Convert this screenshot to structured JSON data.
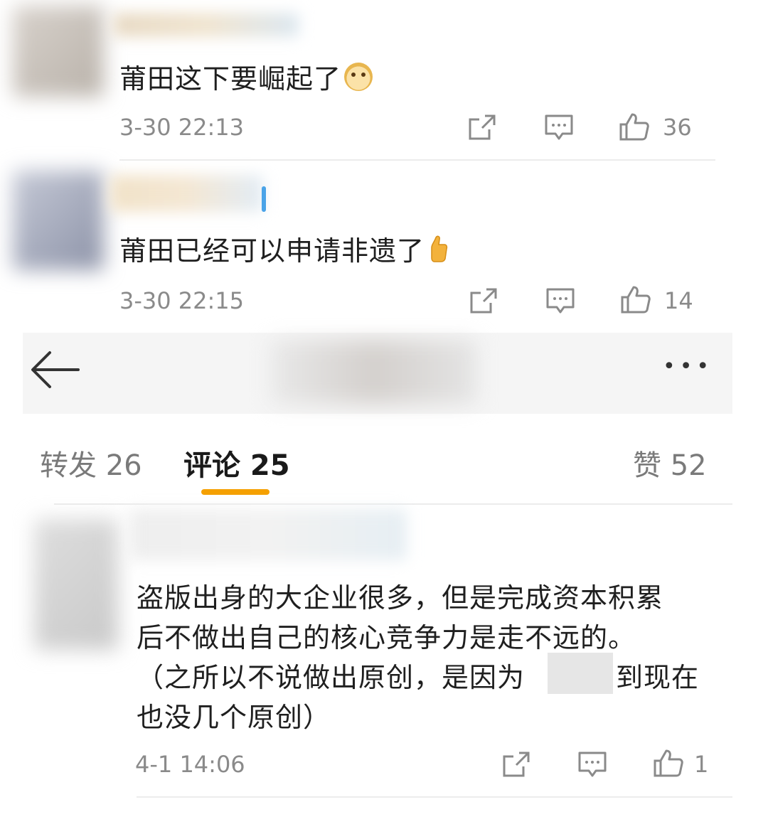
{
  "comments_top": [
    {
      "text": "莆田这下要崛起了",
      "emoji": "doge-emoji",
      "time": "3-30 22:13",
      "likes": "36"
    },
    {
      "text": "莆田已经可以申请非遗了",
      "emoji": "thumbs-up-emoji",
      "time": "3-30 22:15",
      "likes": "14"
    }
  ],
  "header": {
    "more_label": "•••"
  },
  "tabs": [
    {
      "label": "转发 26"
    },
    {
      "label": "评论 25"
    },
    {
      "label": "赞 52"
    }
  ],
  "comment_main": {
    "lines": [
      "盗版出身的大企业很多，但是完成资本积累",
      "后不做出自己的核心竞争力是走不远的。",
      "（之所以不说做出原创，是因为",
      "到现在",
      "也没几个原创）"
    ],
    "time": "4-1 14:06",
    "likes": "1"
  },
  "colors": {
    "accent": "#f5a000",
    "muted": "#8a8a8a",
    "divider": "#ececec"
  }
}
